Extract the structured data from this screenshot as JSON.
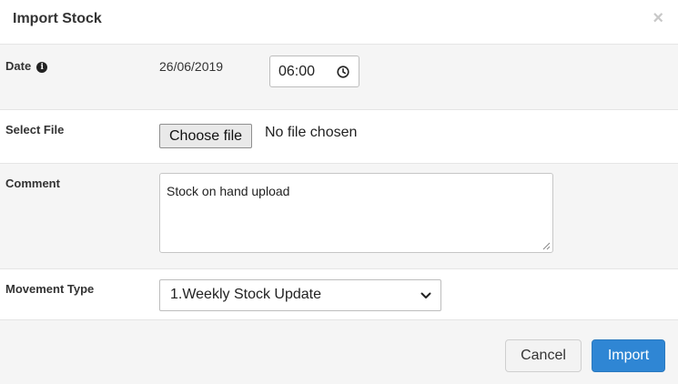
{
  "dialog": {
    "title": "Import Stock",
    "close_glyph": "×"
  },
  "form": {
    "date": {
      "label": "Date",
      "info_icon": "info-icon",
      "date_value": "26/06/2019",
      "time_value": "06:00",
      "time_icon": "clock-icon"
    },
    "file": {
      "label": "Select File",
      "button_label": "Choose file",
      "status": "No file chosen"
    },
    "comment": {
      "label": "Comment",
      "value": "Stock on hand upload"
    },
    "movement": {
      "label": "Movement Type",
      "selected": "1.Weekly Stock Update",
      "dropdown_icon": "chevron-down-icon"
    }
  },
  "footer": {
    "cancel_label": "Cancel",
    "import_label": "Import"
  },
  "colors": {
    "primary": "#2f86d4",
    "row_alt_bg": "#f5f5f5",
    "border": "#e5e5e5"
  }
}
